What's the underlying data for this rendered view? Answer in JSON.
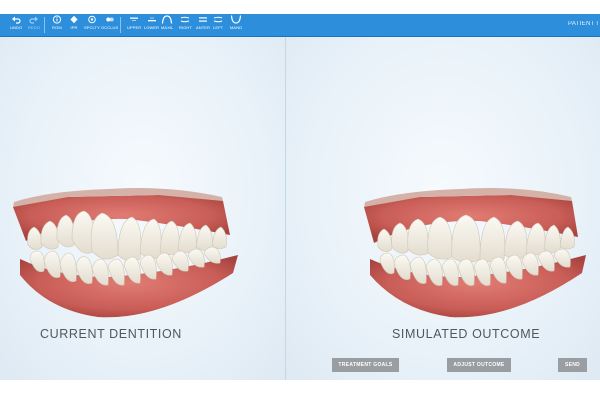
{
  "toolbar": {
    "items": [
      {
        "label": "UNDO",
        "icon": "undo-icon"
      },
      {
        "label": "REDO",
        "icon": "redo-icon"
      },
      {
        "label": "ROM",
        "icon": "info-icon"
      },
      {
        "label": "IPR",
        "icon": "diamond-icon"
      },
      {
        "label": "SPCLTY",
        "icon": "crosshair-icon"
      },
      {
        "label": "OCCLUS",
        "icon": "occlusion-icon"
      },
      {
        "label": "UPPER",
        "icon": "upper-arch-icon"
      },
      {
        "label": "LOWER",
        "icon": "lower-arch-icon"
      },
      {
        "label": "MAXIL",
        "icon": "maxilla-icon"
      },
      {
        "label": "RIGHT",
        "icon": "right-view-icon"
      },
      {
        "label": "ANTER",
        "icon": "anterior-view-icon"
      },
      {
        "label": "LEFT",
        "icon": "left-view-icon"
      },
      {
        "label": "MAND",
        "icon": "mandible-icon"
      }
    ],
    "patient_label": "PATIENT I"
  },
  "panels": {
    "left": {
      "title": "CURRENT DENTITION"
    },
    "right": {
      "title": "SIMULATED OUTCOME"
    }
  },
  "actions": {
    "treatment_goals": "TREATMENT GOALS",
    "adjust_outcome": "ADJUST OUTCOME",
    "send": "SEND"
  },
  "colors": {
    "toolbar": "#2d8fdc",
    "gum": "#c85c57",
    "tooth": "#f2eee4",
    "button": "#999ea3"
  }
}
